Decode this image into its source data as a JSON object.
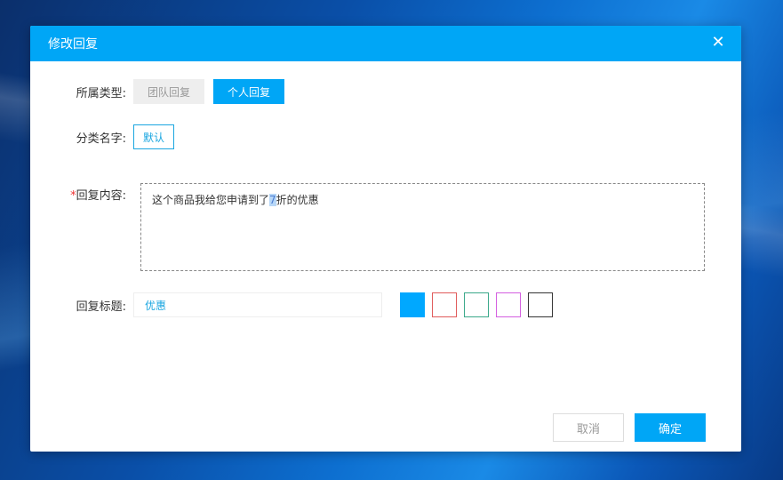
{
  "dialog": {
    "title": "修改回复",
    "close_icon": "close-icon"
  },
  "type": {
    "label": "所属类型:",
    "options": [
      "团队回复",
      "个人回复"
    ],
    "selected": "个人回复"
  },
  "category": {
    "label": "分类名字:",
    "value": "默认"
  },
  "content": {
    "required_mark": "*",
    "label": "回复内容:",
    "text_before": "这个商品我给您申请到了",
    "text_selected": "7",
    "text_after": "折的优惠"
  },
  "title_field": {
    "label": "回复标题:",
    "value": "优惠"
  },
  "colors": [
    "#00a8ff",
    "#e05a5a",
    "#3aa88a",
    "#d45ee0",
    "#333333"
  ],
  "selected_color": "#00a8ff",
  "footer": {
    "cancel": "取消",
    "confirm": "确定"
  }
}
